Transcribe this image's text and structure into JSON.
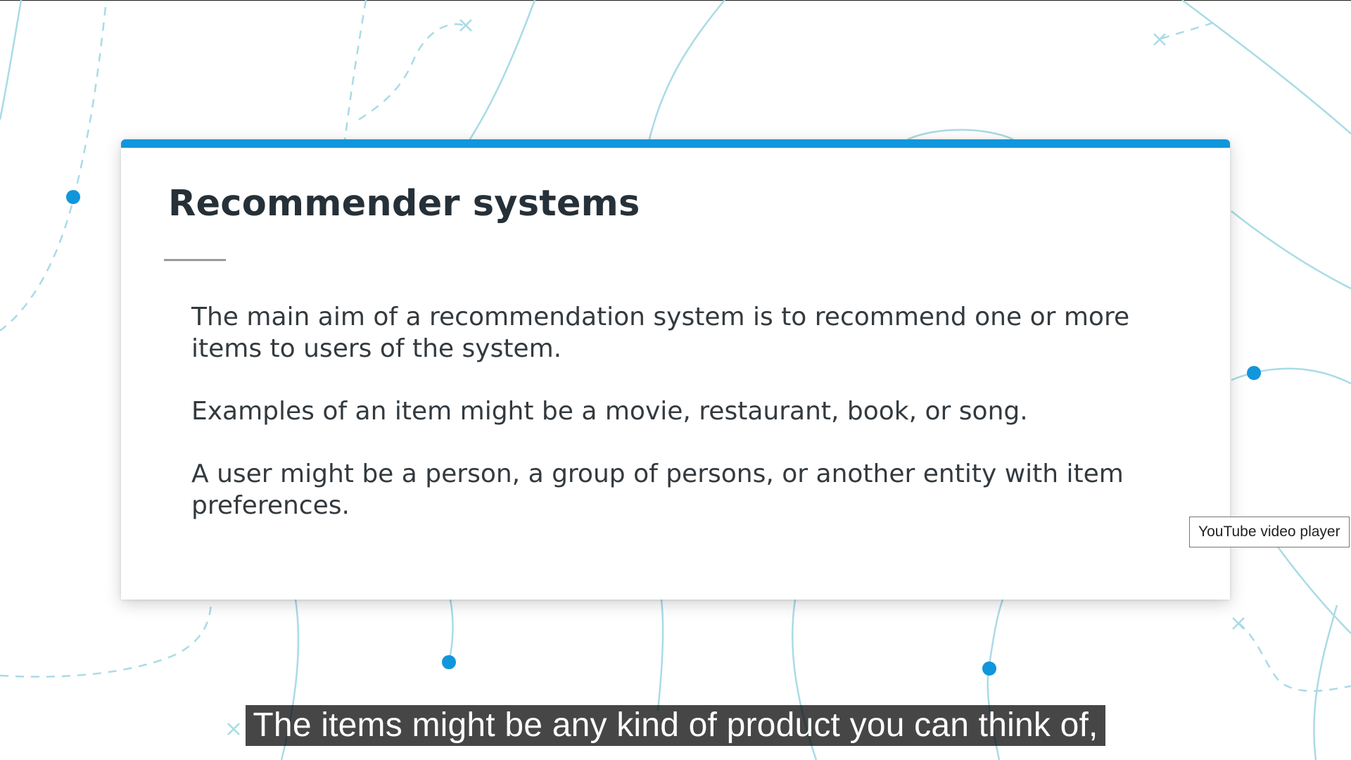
{
  "player": {
    "tooltip": "YouTube video player",
    "caption": "The items might be any kind of product you can think of,"
  },
  "slide": {
    "title": "Recommender systems",
    "paragraphs": [
      "The main aim of a recommendation system is to recommend one or more items to users of the system.",
      "Examples of an item might be a movie, restaurant, book, or song.",
      "A user might be a person, a group of persons, or another entity with item preferences."
    ]
  },
  "colors": {
    "accent": "#1196dc",
    "background_lines": "#a9dbe6",
    "title": "#263038",
    "body_text": "#333a3f",
    "caption_bg": "#080808"
  }
}
